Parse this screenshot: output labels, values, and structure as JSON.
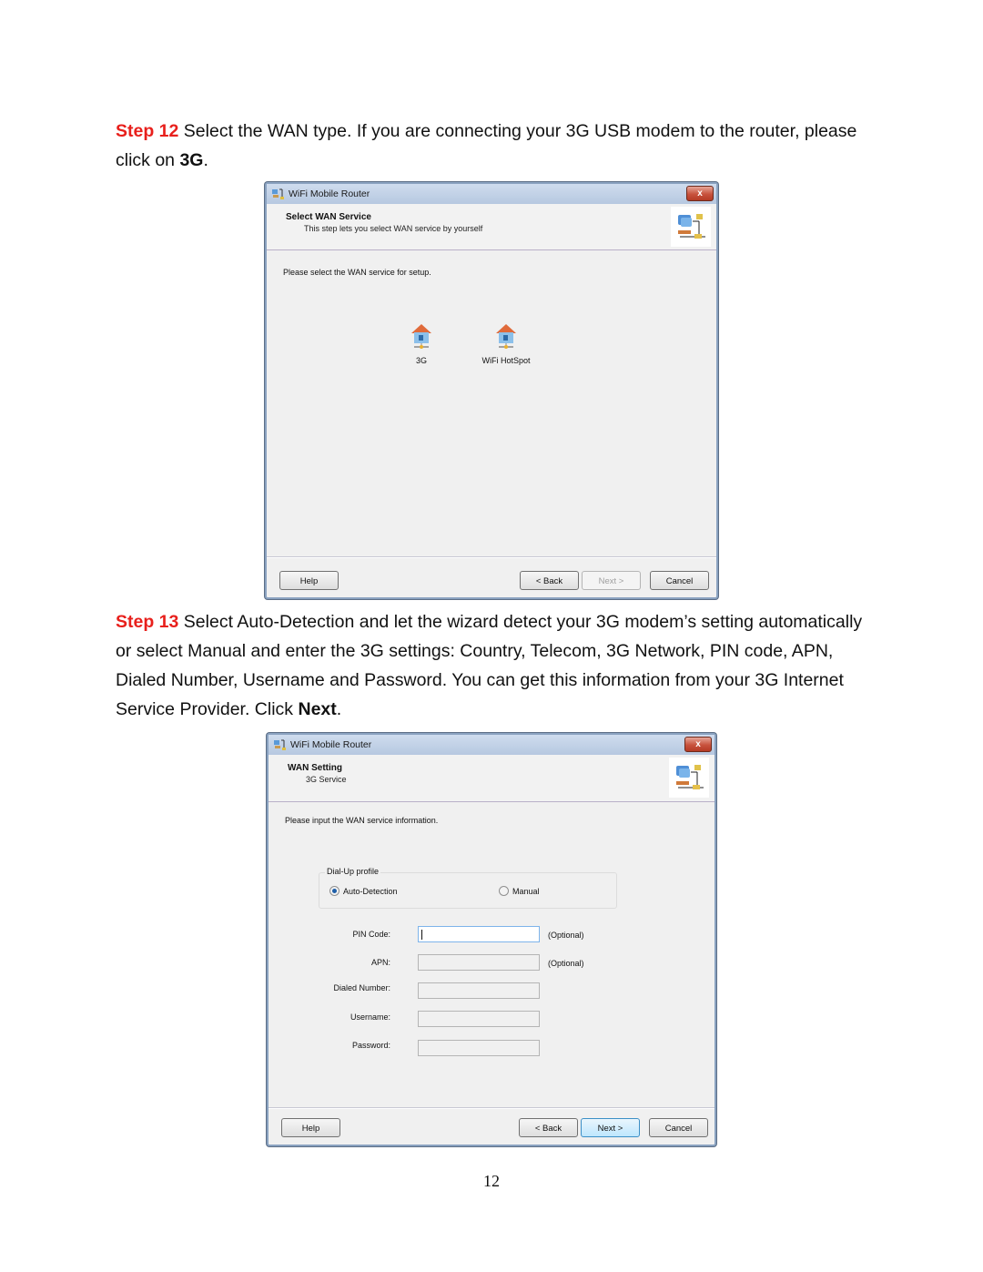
{
  "step12": {
    "step_label": "Step 12",
    "text_before": " Select the WAN type. If you are connecting your 3G USB modem to the router, please click on ",
    "bold": "3G",
    "text_after": "."
  },
  "dialog1": {
    "window_title": "WiFi Mobile Router",
    "close_label": "x",
    "header_title": "Select WAN Service",
    "header_subtitle": "This step lets you select WAN service by yourself",
    "instruction": "Please select the WAN service for setup.",
    "services": [
      {
        "label": "3G",
        "icon": "house-network-icon"
      },
      {
        "label": "WiFi HotSpot",
        "icon": "house-network-icon"
      }
    ],
    "buttons": {
      "help": "Help",
      "back": "< Back",
      "next": "Next >",
      "cancel": "Cancel"
    },
    "next_enabled": false
  },
  "step13": {
    "step_label": "Step 13",
    "text_before": " Select Auto-Detection and let the wizard detect your 3G modem’s setting automatically or select Manual and enter the 3G settings: Country, Telecom, 3G Network, PIN code, APN, Dialed Number, Username and Password. You can get this information from your 3G Internet Service Provider. Click ",
    "bold": "Next",
    "text_after": "."
  },
  "dialog2": {
    "window_title": "WiFi Mobile Router",
    "close_label": "x",
    "header_title": "WAN Setting",
    "header_subtitle": "3G Service",
    "instruction": "Please input the WAN service information.",
    "dialup_profile": {
      "legend": "Dial-Up profile",
      "options": [
        {
          "label": "Auto-Detection",
          "selected": true
        },
        {
          "label": "Manual",
          "selected": false
        }
      ]
    },
    "fields": [
      {
        "label": "PIN Code:",
        "value": "",
        "note": "(Optional)",
        "active": true
      },
      {
        "label": "APN:",
        "value": "",
        "note": "(Optional)",
        "active": false
      },
      {
        "label": "Dialed Number:",
        "value": "",
        "note": "",
        "active": false
      },
      {
        "label": "Username:",
        "value": "",
        "note": "",
        "active": false
      },
      {
        "label": "Password:",
        "value": "",
        "note": "",
        "active": false
      }
    ],
    "buttons": {
      "help": "Help",
      "back": "< Back",
      "next": "Next >",
      "cancel": "Cancel"
    },
    "next_enabled": true
  },
  "page_number": "12"
}
